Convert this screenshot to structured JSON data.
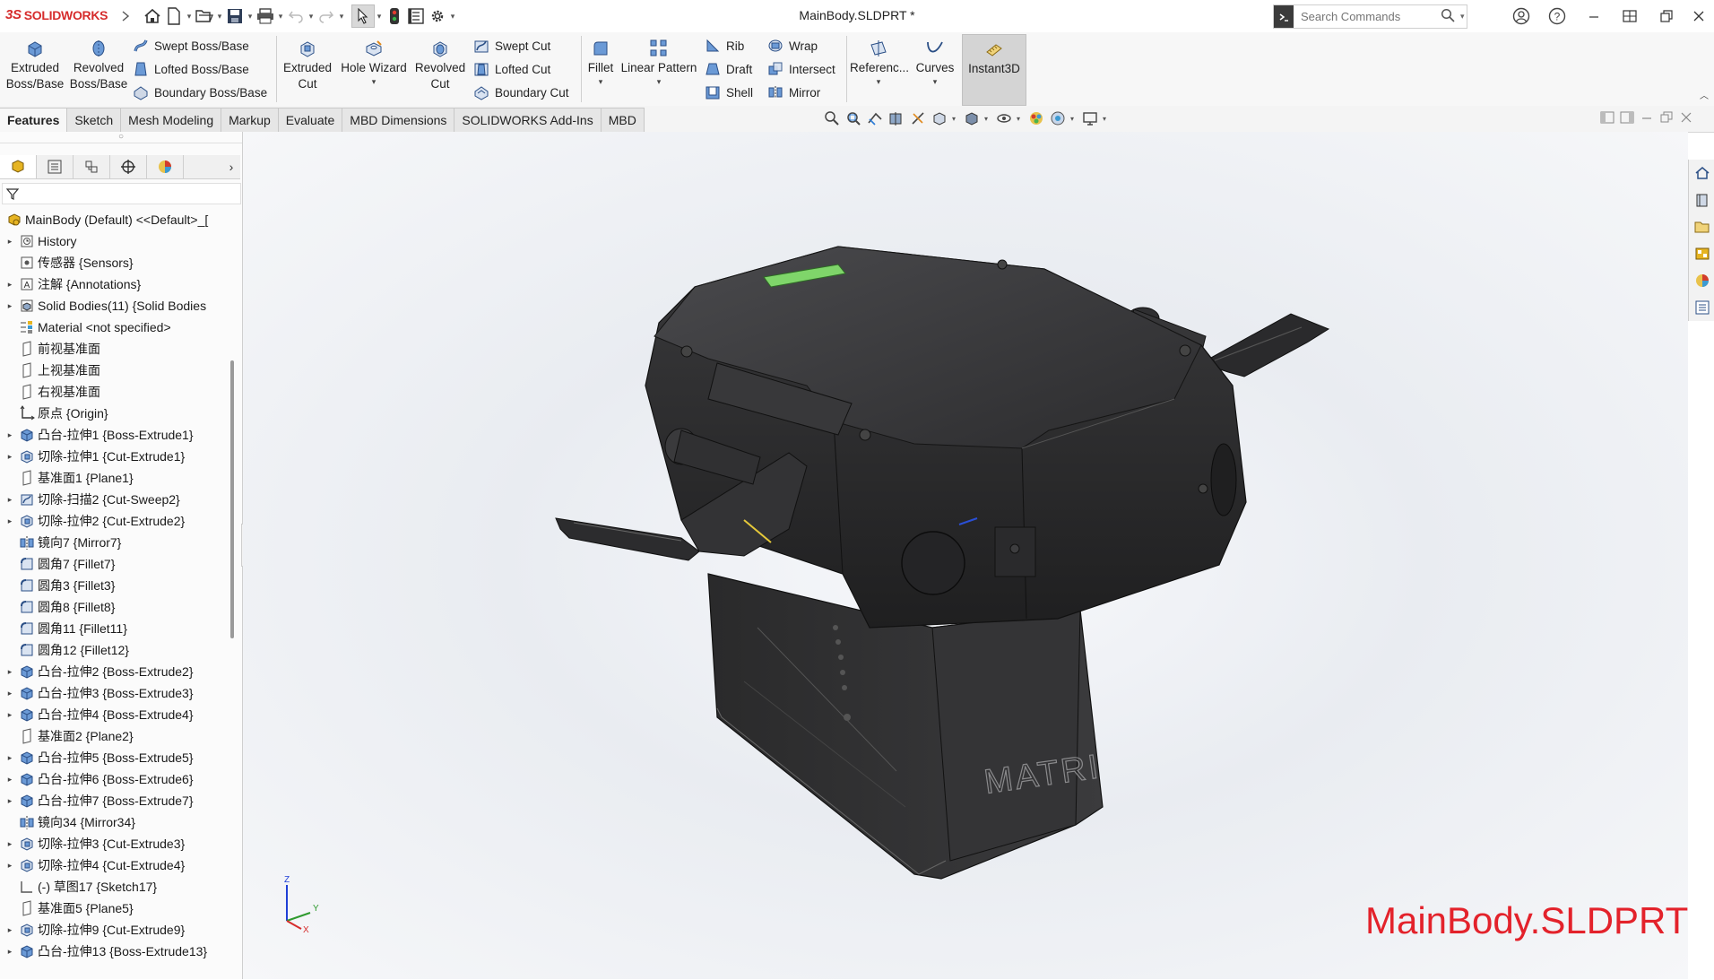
{
  "app": {
    "brand": "SOLIDWORKS",
    "document_title": "MainBody.SLDPRT *"
  },
  "search": {
    "placeholder": "Search Commands"
  },
  "ribbon": {
    "extruded_boss": "Extruded\nBoss/Base",
    "revolved_boss": "Revolved\nBoss/Base",
    "swept_boss": "Swept Boss/Base",
    "lofted_boss": "Lofted Boss/Base",
    "boundary_boss": "Boundary Boss/Base",
    "extruded_cut": "Extruded\nCut",
    "hole_wizard": "Hole Wizard",
    "revolved_cut": "Revolved\nCut",
    "swept_cut": "Swept Cut",
    "lofted_cut": "Lofted Cut",
    "boundary_cut": "Boundary Cut",
    "fillet": "Fillet",
    "linear_pattern": "Linear Pattern",
    "rib": "Rib",
    "draft": "Draft",
    "shell": "Shell",
    "wrap": "Wrap",
    "intersect": "Intersect",
    "mirror": "Mirror",
    "reference": "Referenc...",
    "curves": "Curves",
    "instant3d": "Instant3D"
  },
  "tabs": [
    "Features",
    "Sketch",
    "Mesh Modeling",
    "Markup",
    "Evaluate",
    "MBD Dimensions",
    "SOLIDWORKS Add-Ins",
    "MBD"
  ],
  "tree": {
    "root": "MainBody (Default) <<Default>_[",
    "items": [
      {
        "label": "History",
        "icon": "history-icon",
        "expand": true
      },
      {
        "label": "传感器 {Sensors}",
        "icon": "sensor-icon",
        "expand": false
      },
      {
        "label": "注解 {Annotations}",
        "icon": "annotation-icon",
        "expand": true
      },
      {
        "label": "Solid Bodies(11) {Solid Bodies",
        "icon": "solid-bodies-icon",
        "expand": true
      },
      {
        "label": "Material <not specified>",
        "icon": "material-icon",
        "expand": false
      },
      {
        "label": "前视基准面",
        "icon": "plane-icon",
        "expand": false
      },
      {
        "label": "上视基准面",
        "icon": "plane-icon",
        "expand": false
      },
      {
        "label": "右视基准面",
        "icon": "plane-icon",
        "expand": false
      },
      {
        "label": "原点 {Origin}",
        "icon": "origin-icon",
        "expand": false
      },
      {
        "label": "凸台-拉伸1 {Boss-Extrude1}",
        "icon": "extrude-icon",
        "expand": true
      },
      {
        "label": "切除-拉伸1 {Cut-Extrude1}",
        "icon": "cut-extrude-icon",
        "expand": true
      },
      {
        "label": "基准面1 {Plane1}",
        "icon": "plane-icon",
        "expand": false
      },
      {
        "label": "切除-扫描2 {Cut-Sweep2}",
        "icon": "cut-sweep-icon",
        "expand": true
      },
      {
        "label": "切除-拉伸2 {Cut-Extrude2}",
        "icon": "cut-extrude-icon",
        "expand": true
      },
      {
        "label": "镜向7 {Mirror7}",
        "icon": "mirror-icon",
        "expand": false
      },
      {
        "label": "圆角7 {Fillet7}",
        "icon": "fillet-icon",
        "expand": false
      },
      {
        "label": "圆角3 {Fillet3}",
        "icon": "fillet-icon",
        "expand": false
      },
      {
        "label": "圆角8 {Fillet8}",
        "icon": "fillet-icon",
        "expand": false
      },
      {
        "label": "圆角11 {Fillet11}",
        "icon": "fillet-icon",
        "expand": false
      },
      {
        "label": "圆角12 {Fillet12}",
        "icon": "fillet-icon",
        "expand": false
      },
      {
        "label": "凸台-拉伸2 {Boss-Extrude2}",
        "icon": "extrude-icon",
        "expand": true
      },
      {
        "label": "凸台-拉伸3 {Boss-Extrude3}",
        "icon": "extrude-icon",
        "expand": true
      },
      {
        "label": "凸台-拉伸4 {Boss-Extrude4}",
        "icon": "extrude-icon",
        "expand": true
      },
      {
        "label": "基准面2 {Plane2}",
        "icon": "plane-icon",
        "expand": false
      },
      {
        "label": "凸台-拉伸5 {Boss-Extrude5}",
        "icon": "extrude-icon",
        "expand": true
      },
      {
        "label": "凸台-拉伸6 {Boss-Extrude6}",
        "icon": "extrude-icon",
        "expand": true
      },
      {
        "label": "凸台-拉伸7 {Boss-Extrude7}",
        "icon": "extrude-icon",
        "expand": true
      },
      {
        "label": "镜向34 {Mirror34}",
        "icon": "mirror-icon",
        "expand": false
      },
      {
        "label": "切除-拉伸3 {Cut-Extrude3}",
        "icon": "cut-extrude-icon",
        "expand": true
      },
      {
        "label": "切除-拉伸4 {Cut-Extrude4}",
        "icon": "cut-extrude-icon",
        "expand": true
      },
      {
        "label": "(-) 草图17 {Sketch17}",
        "icon": "sketch-icon",
        "expand": false
      },
      {
        "label": "基准面5 {Plane5}",
        "icon": "plane-icon",
        "expand": false
      },
      {
        "label": "切除-拉伸9 {Cut-Extrude9}",
        "icon": "cut-extrude-icon",
        "expand": true
      },
      {
        "label": "凸台-拉伸13 {Boss-Extrude13}",
        "icon": "extrude-icon",
        "expand": true
      }
    ]
  },
  "viewport": {
    "model_text": "MATRI",
    "watermark": "MainBody.SLDPRT",
    "triad": {
      "x": "X",
      "y": "Y",
      "z": "Z"
    }
  },
  "colors": {
    "brand_red": "#d62c2c",
    "watermark_red": "#e3222b",
    "model_body": "#2f2f31",
    "green_window": "#7fd56a"
  }
}
